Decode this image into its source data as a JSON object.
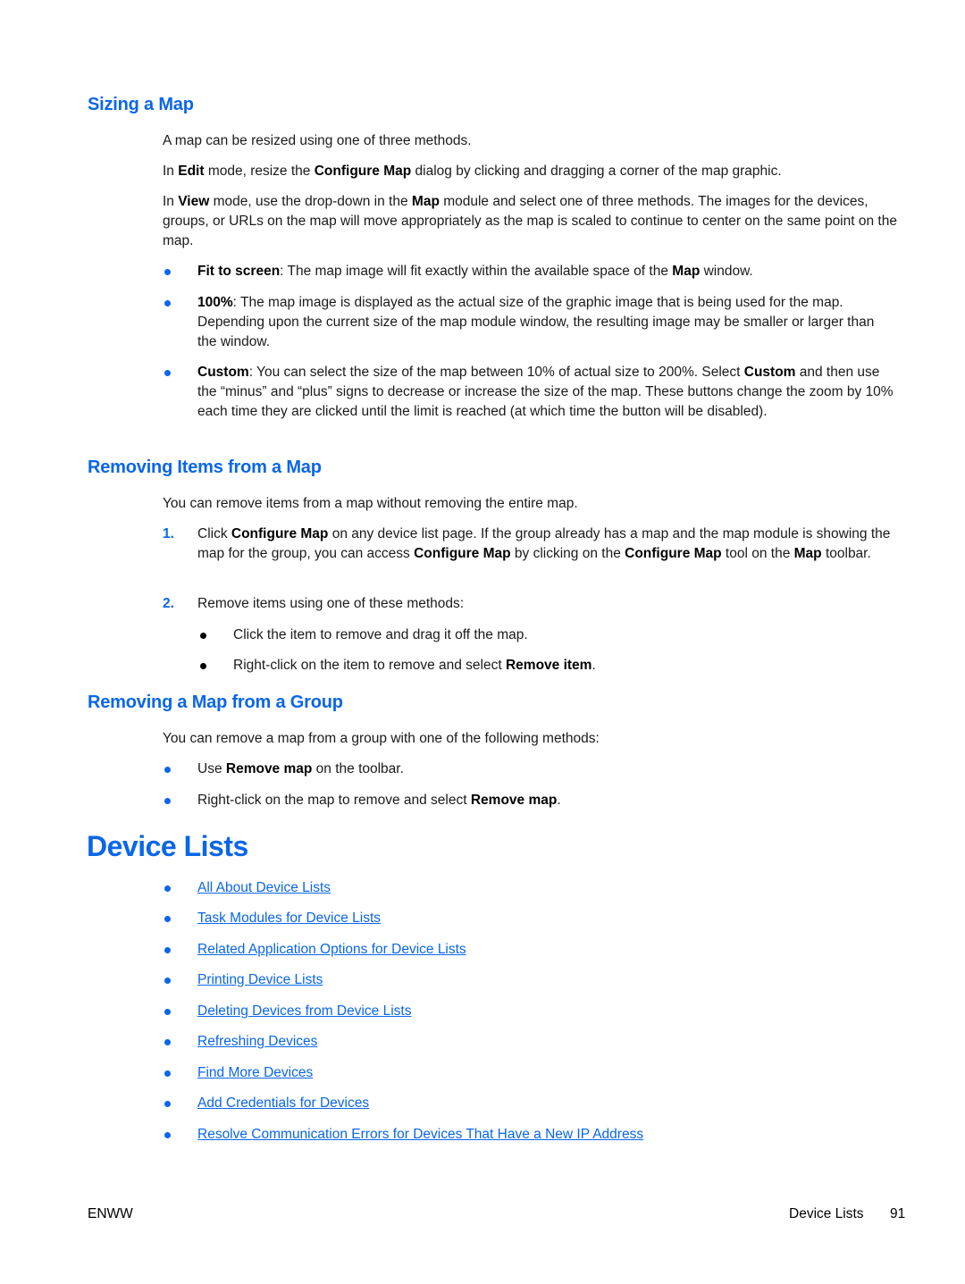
{
  "sections": {
    "sizing": {
      "heading": "Sizing a Map",
      "intro": "A map can be resized using one of three methods.",
      "edit_para": {
        "t1": "In ",
        "b1": "Edit",
        "t2": " mode, resize the ",
        "b2": "Configure Map",
        "t3": " dialog by clicking and dragging a corner of the map graphic."
      },
      "view_para": {
        "t1": "In ",
        "b1": "View",
        "t2": " mode, use the drop-down in the ",
        "b2": "Map",
        "t3": " module and select one of three methods. The images for the devices, groups, or URLs on the map will move appropriately as the map is scaled to continue to center on the same point on the map."
      },
      "bullets": [
        {
          "bold": "Fit to screen",
          "t1": ": The map image will fit exactly within the available space of the ",
          "b2": "Map",
          "t2": " window."
        },
        {
          "bold": "100%",
          "t1": ": The map image is displayed as the actual size of the graphic image that is being used for the map. Depending upon the current size of the map module window, the resulting image may be smaller or larger than the window."
        },
        {
          "bold": "Custom",
          "t1": ": You can select the size of the map between 10% of actual size to 200%. Select ",
          "b2": "Custom",
          "t2": " and then use the “minus” and “plus” signs to decrease or increase the size of the map. These buttons change the zoom by 10% each time they are clicked until the limit is reached (at which time the button will be disabled)."
        }
      ]
    },
    "removing_items": {
      "heading": "Removing Items from a Map",
      "intro": "You can remove items from a map without removing the entire map.",
      "steps": [
        {
          "num": "1.",
          "t1": "Click ",
          "b1": "Configure Map",
          "t2": " on any device list page. If the group already has a map and the map module is showing the map for the group, you can access ",
          "b2": "Configure Map",
          "t3": " by clicking on the ",
          "b3": "Configure Map",
          "t4": " tool on the ",
          "b4": "Map",
          "t5": " toolbar."
        },
        {
          "num": "2.",
          "t1": "Remove items using one of these methods:"
        }
      ],
      "sub_bullets": [
        {
          "t1": "Click the item to remove and drag it off the map."
        },
        {
          "t1": "Right-click on the item to remove and select ",
          "b1": "Remove item",
          "t2": "."
        }
      ]
    },
    "removing_map": {
      "heading": "Removing a Map from a Group",
      "intro": "You can remove a map from a group with one of the following methods:",
      "bullets": [
        {
          "t1": "Use ",
          "b1": "Remove map",
          "t2": " on the toolbar."
        },
        {
          "t1": "Right-click on the map to remove and select ",
          "b1": "Remove map",
          "t2": "."
        }
      ]
    }
  },
  "chapter": {
    "title": "Device Lists",
    "links": [
      "All About Device Lists",
      "Task Modules for Device Lists",
      "Related Application Options for Device Lists",
      "Printing Device Lists",
      "Deleting Devices from Device Lists",
      "Refreshing Devices",
      "Find More Devices",
      "Add Credentials for Devices",
      "Resolve Communication Errors for Devices That Have a New IP Address"
    ]
  },
  "footer": {
    "left": "ENWW",
    "section": "Device Lists",
    "page": "91"
  },
  "colors": {
    "accent": "#0a66e8",
    "text": "#1a1a1a"
  }
}
